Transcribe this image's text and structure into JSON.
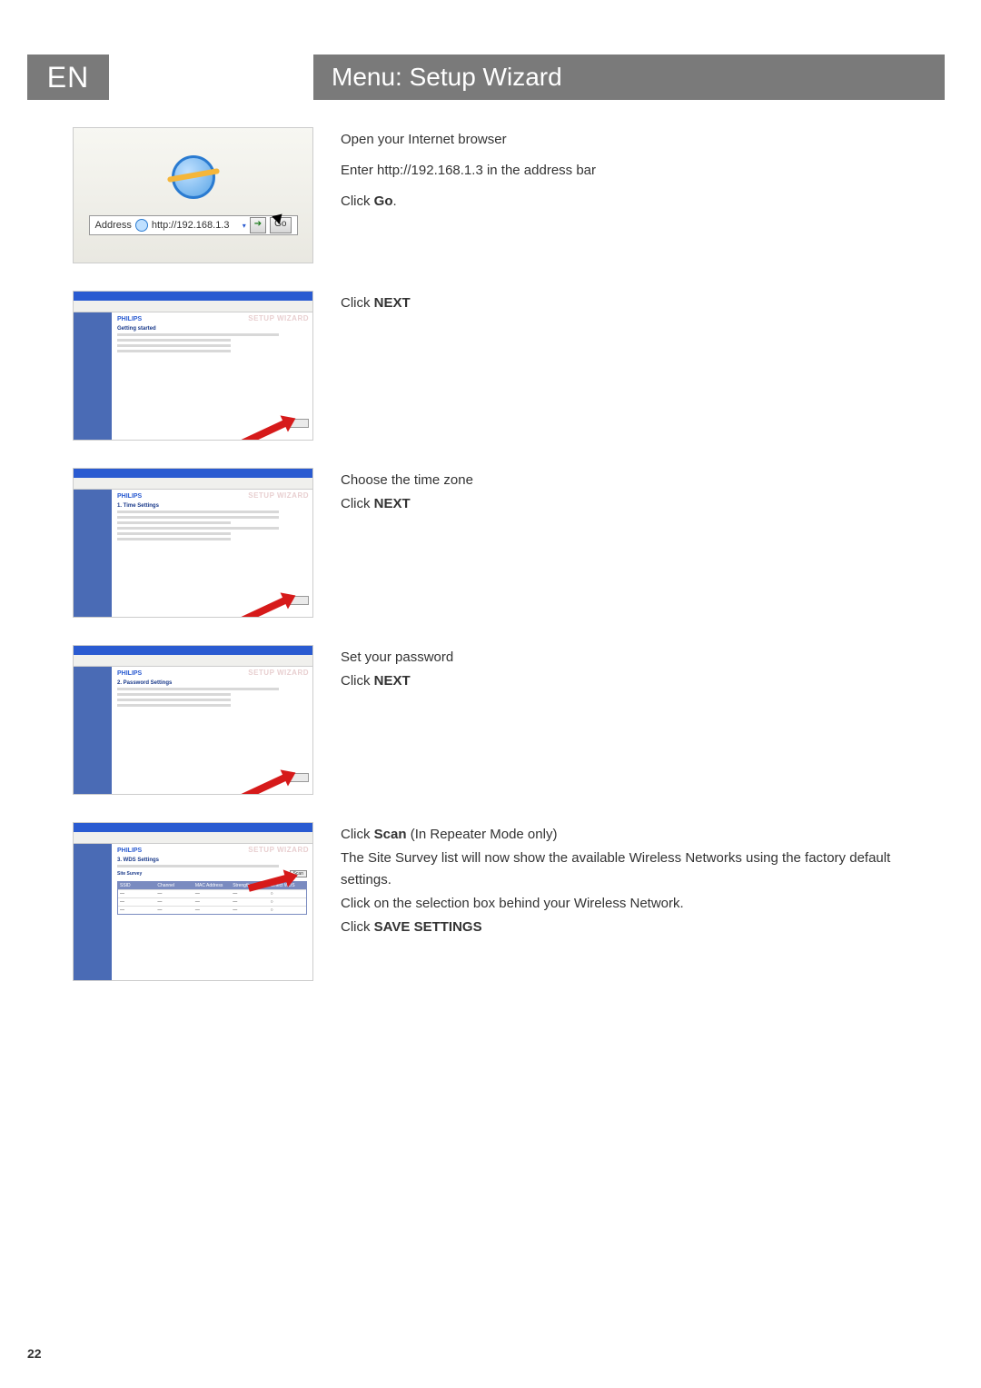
{
  "lang": "EN",
  "title": "Menu: Setup Wizard",
  "page_number": "22",
  "addr": {
    "label": "Address",
    "url": "http://192.168.1.3",
    "go": "Go"
  },
  "step1": {
    "line1": "Open your Internet browser",
    "line2": "Enter http://192.168.1.3 in the address bar",
    "line3_a": "Click ",
    "line3_b": "Go",
    "line3_c": "."
  },
  "step2": {
    "line1_a": "Click ",
    "line1_b": "NEXT"
  },
  "step3": {
    "line1": "Choose the time zone",
    "line2_a": "Click ",
    "line2_b": "NEXT"
  },
  "step4": {
    "line1": "Set your password",
    "line2_a": "Click ",
    "line2_b": "NEXT"
  },
  "step5": {
    "line1_a": "Click ",
    "line1_b": "Scan",
    "line1_c": " (In Repeater Mode only)",
    "line2": "The Site Survey list will now show the available Wireless Networks using the factory default settings.",
    "line3": "Click on the selection box behind your Wireless Network.",
    "line4_a": "Click ",
    "line4_b": "SAVE SETTINGS"
  },
  "wiz": {
    "brand": "PHILIPS",
    "ghost": "SETUP WIZARD",
    "getting_started": "Getting started",
    "time_settings": "1. Time Settings",
    "pwd_settings": "2. Password Settings",
    "wds_settings": "3. WDS Settings",
    "site_survey": "Site Survey",
    "scan": "Scan",
    "tbl_h1": "SSID",
    "tbl_h2": "Channel",
    "tbl_h3": "MAC Address",
    "tbl_h4": "Strength",
    "tbl_h5": "Select WDS"
  }
}
